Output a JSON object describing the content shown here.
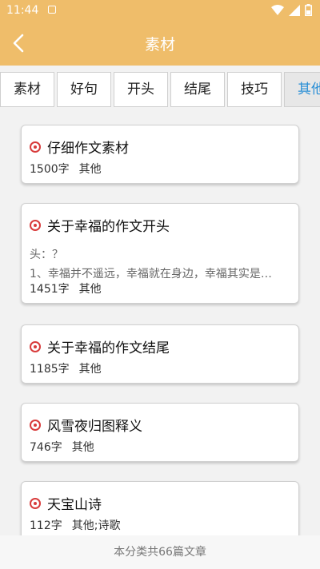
{
  "status": {
    "time": "11:44"
  },
  "appbar": {
    "title": "素材",
    "back_icon": "back-arrow-icon"
  },
  "tabs": [
    {
      "label": "素材"
    },
    {
      "label": "好句"
    },
    {
      "label": "开头"
    },
    {
      "label": "结尾"
    },
    {
      "label": "技巧"
    },
    {
      "label": "其他",
      "active": true
    }
  ],
  "articles": [
    {
      "title": "仔细作文素材",
      "words": "1500字",
      "category": "其他"
    },
    {
      "title": "关于幸福的作文开头",
      "excerpt_line1": "头：？",
      "excerpt_line2": "1、幸福并不遥远，幸福就在身边，幸福其实是…",
      "words": "1451字",
      "category": "其他"
    },
    {
      "title": "关于幸福的作文结尾",
      "words": "1185字",
      "category": "其他"
    },
    {
      "title": "风雪夜归图释义",
      "words": "746字",
      "category": "其他"
    },
    {
      "title": "天宝山诗",
      "words": "112字",
      "category": "其他;诗歌"
    }
  ],
  "footer": {
    "summary": "本分类共66篇文章"
  },
  "colors": {
    "appbar": "#efbd6a",
    "active_tab": "#2a8fd6",
    "bullet": "#d83b3b"
  }
}
